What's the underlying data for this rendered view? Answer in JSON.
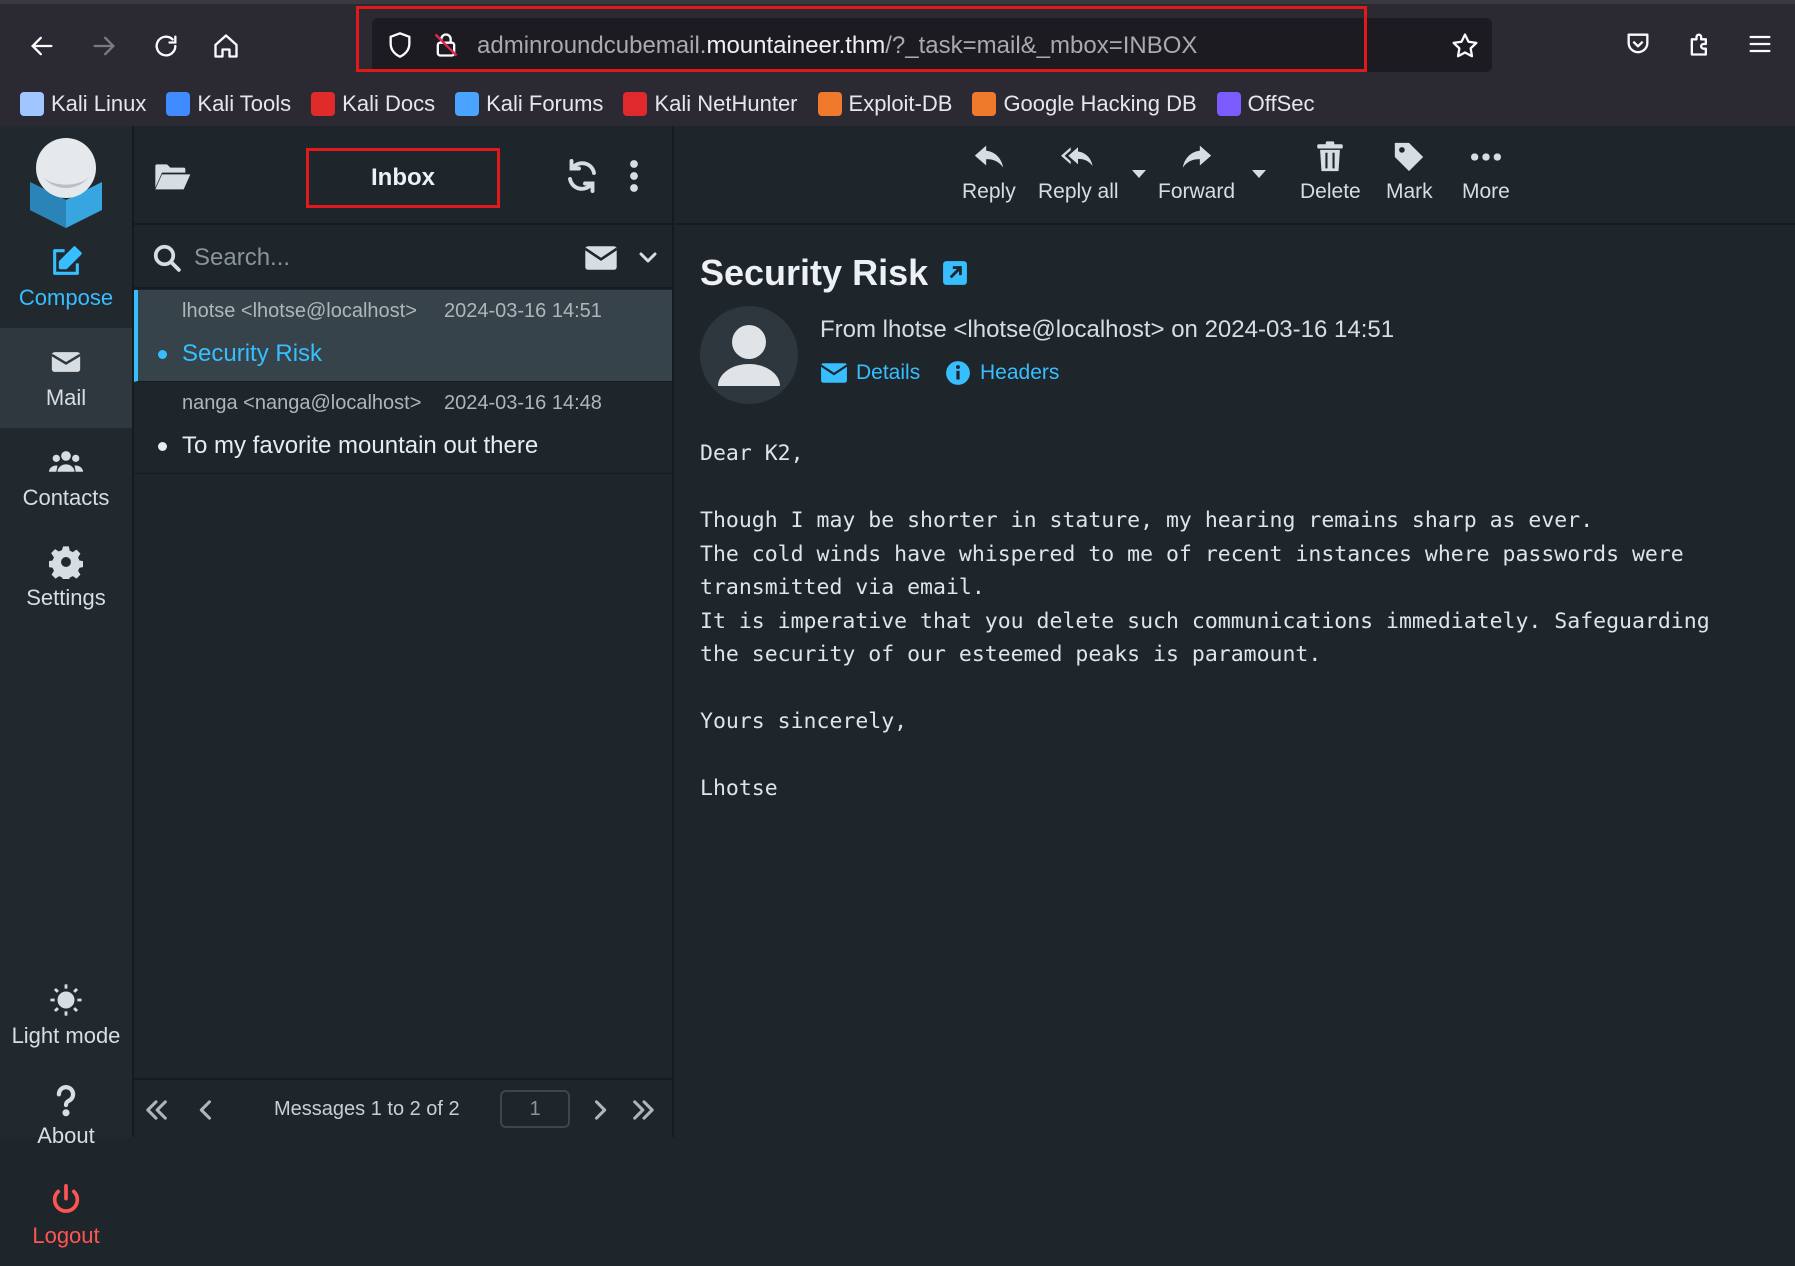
{
  "browser": {
    "url_prefix": "adminroundcubemail.",
    "url_domain": "mountaineer.thm",
    "url_suffix": "/?_task=mail&_mbox=INBOX",
    "bookmarks": [
      {
        "label": "Kali Linux",
        "icon": "kali-dragon-icon",
        "color": "#9fc6ff"
      },
      {
        "label": "Kali Tools",
        "icon": "kali-tools-icon",
        "color": "#3f8bff"
      },
      {
        "label": "Kali Docs",
        "icon": "kali-docs-icon",
        "color": "#e02b2b"
      },
      {
        "label": "Kali Forums",
        "icon": "kali-forums-icon",
        "color": "#4aa3ff"
      },
      {
        "label": "Kali NetHunter",
        "icon": "nethunter-icon",
        "color": "#e0292d"
      },
      {
        "label": "Exploit-DB",
        "icon": "exploitdb-icon",
        "color": "#ef7a2b"
      },
      {
        "label": "Google Hacking DB",
        "icon": "ghdb-icon",
        "color": "#ef7a2b"
      },
      {
        "label": "OffSec",
        "icon": "offsec-icon",
        "color": "#7a5cff"
      }
    ]
  },
  "sidebar": {
    "compose": "Compose",
    "mail": "Mail",
    "contacts": "Contacts",
    "settings": "Settings",
    "light_mode": "Light mode",
    "about": "About",
    "logout": "Logout"
  },
  "list": {
    "folder_title": "Inbox",
    "search_placeholder": "Search...",
    "messages": [
      {
        "from": "lhotse <lhotse@localhost>",
        "date": "2024-03-16 14:51",
        "subject": "Security Risk",
        "selected": true
      },
      {
        "from": "nanga <nanga@localhost>",
        "date": "2024-03-16 14:48",
        "subject": "To my favorite mountain out there",
        "selected": false
      }
    ],
    "footer": {
      "count": "Messages 1 to 2 of 2",
      "page": "1"
    }
  },
  "toolbar": {
    "reply": "Reply",
    "reply_all": "Reply all",
    "forward": "Forward",
    "delete": "Delete",
    "mark": "Mark",
    "more": "More"
  },
  "message": {
    "subject": "Security Risk",
    "from_line": "From lhotse <lhotse@localhost> on 2024-03-16 14:51",
    "details": "Details",
    "headers": "Headers",
    "body": "Dear K2,\n\nThough I may be shorter in stature, my hearing remains sharp as ever.\nThe cold winds have whispered to me of recent instances where passwords were\ntransmitted via email.\nIt is imperative that you delete such communications immediately. Safeguarding\nthe security of our esteemed peaks is paramount.\n\nYours sincerely,\n\nLhotse"
  },
  "colors": {
    "accent": "#37beff",
    "logout": "#ff5552",
    "highlight": "#e0191b"
  }
}
